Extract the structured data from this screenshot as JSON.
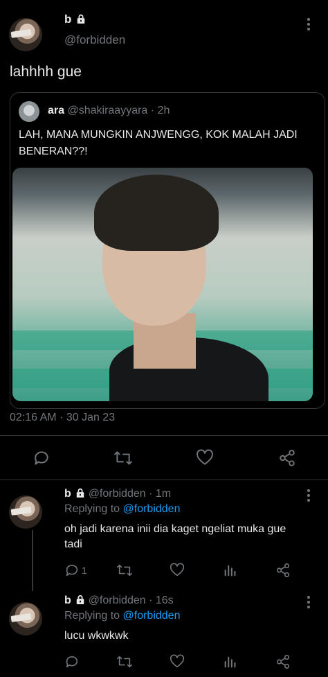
{
  "main_tweet": {
    "name": "b",
    "handle": "@forbidden",
    "text": "lahhhh gue",
    "timestamp": "02:16 AM · 30 Jan 23"
  },
  "quote": {
    "name": "ara",
    "handle": "@shakiraayyara",
    "time": "· 2h",
    "text": "LAH, MANA MUNGKIN ANJWENGG, KOK MALAH JADI BENERAN??!"
  },
  "replies": [
    {
      "name": "b",
      "handle": "@forbidden",
      "time": "· 1m",
      "replying_prefix": "Replying to",
      "replying_to": "@forbidden",
      "text": "oh jadi karena inii dia kaget ngeliat muka gue tadi",
      "reply_count": "1"
    },
    {
      "name": "b",
      "handle": "@forbidden",
      "time": "· 16s",
      "replying_prefix": "Replying to",
      "replying_to": "@forbidden",
      "text": "lucu wkwkwk"
    }
  ],
  "colors": {
    "background": "#000000",
    "text": "#e7e9ea",
    "muted": "#71767b",
    "link": "#1d9bf0",
    "divider": "#2f3336"
  },
  "icons": [
    "lock-icon",
    "more-icon",
    "reply-icon",
    "retweet-icon",
    "like-icon",
    "analytics-icon",
    "share-icon"
  ]
}
